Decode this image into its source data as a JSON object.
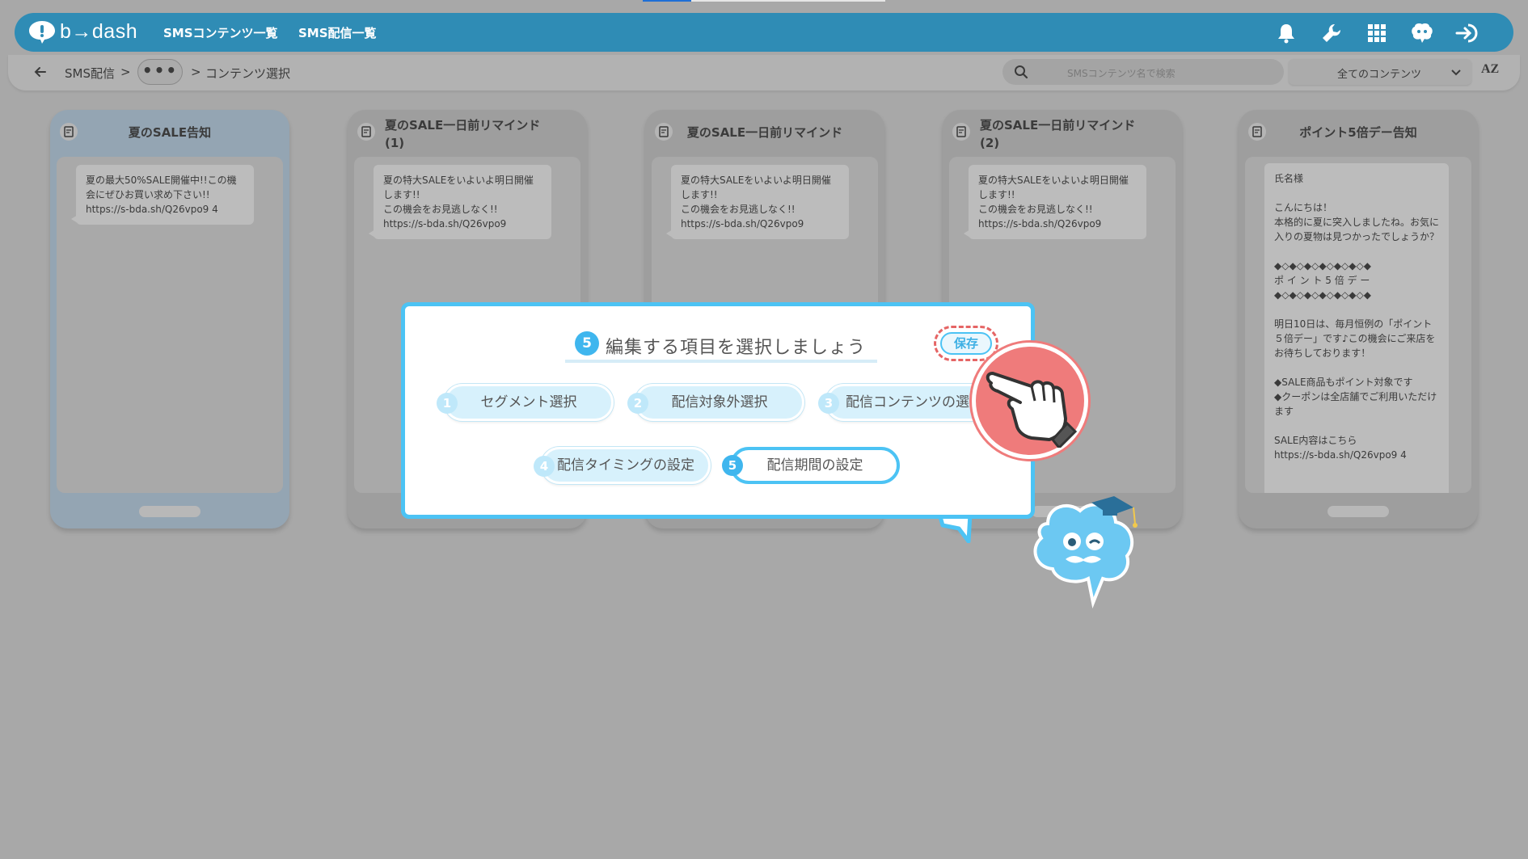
{
  "app": {
    "logo_text": "b→dash",
    "nav": [
      "SMSコンテンツ一覧",
      "SMS配信一覧"
    ],
    "header_icons": [
      "bell-icon",
      "wrench-icon",
      "grid-icon",
      "mascot-chat-icon",
      "logout-icon"
    ]
  },
  "breadcrumb": {
    "items": [
      "SMS配信",
      "コンテンツ選択"
    ],
    "separator": ">",
    "more": "•••"
  },
  "search": {
    "placeholder": "SMSコンテンツ名で検索"
  },
  "filter": {
    "selected": "全てのコンテンツ"
  },
  "sort": {
    "label": "AZ"
  },
  "cards": [
    {
      "title": "夏のSALE告知",
      "message": "夏の最大50%SALE開催中!!この機会にぜひお買い求め下さい!!\nhttps://s-bda.sh/Q26vpo9 4"
    },
    {
      "title": "夏のSALE一日前リマインド\n(1)",
      "message": "夏の特大SALEをいよいよ明日開催します!!\nこの機会をお見逃しなく!!\nhttps://s-bda.sh/Q26vpo9"
    },
    {
      "title": "夏のSALE一日前リマインド",
      "message": "夏の特大SALEをいよいよ明日開催します!!\nこの機会をお見逃しなく!!\nhttps://s-bda.sh/Q26vpo9"
    },
    {
      "title": "夏のSALE一日前リマインド\n(2)",
      "message": "夏の特大SALEをいよいよ明日開催します!!\nこの機会をお見逃しなく!!\nhttps://s-bda.sh/Q26vpo9"
    },
    {
      "title": "ポイント5倍デー告知",
      "message": "氏名様\n\nこんにちは！\n本格的に夏に突入しましたね。お気に入りの夏物は見つかったでしょうか？\n\n◆◇◆◇◆◇◆◇◆◇◆◇◆\nポ イ ン ト 5 倍 デ ー\n◆◇◆◇◆◇◆◇◆◇◆◇◆\n\n明日10日は、毎月恒例の「ポイント５倍デー」です♪この機会にご来店をお待ちしております！\n\n◆SALE商品もポイント対象です\n◆クーポンは全店舗でご利用いただけます\n\nSALE内容はこちら\nhttps://s-bda.sh/Q26vpo9 4"
    }
  ],
  "modal": {
    "step": "5",
    "title": "編集する項目を選択しましょう",
    "save_label": "保存",
    "options": [
      {
        "num": "1",
        "label": "セグメント選択"
      },
      {
        "num": "2",
        "label": "配信対象外選択"
      },
      {
        "num": "3",
        "label": "配信コンテンツの選択"
      },
      {
        "num": "4",
        "label": "配信タイミングの設定"
      },
      {
        "num": "5",
        "label": "配信期間の設定"
      }
    ]
  },
  "colors": {
    "header": "#2f8cb5",
    "accent": "#4cc3f4",
    "highlight": "#ef7b7b",
    "overlay_bg": "#a8a8a8"
  }
}
